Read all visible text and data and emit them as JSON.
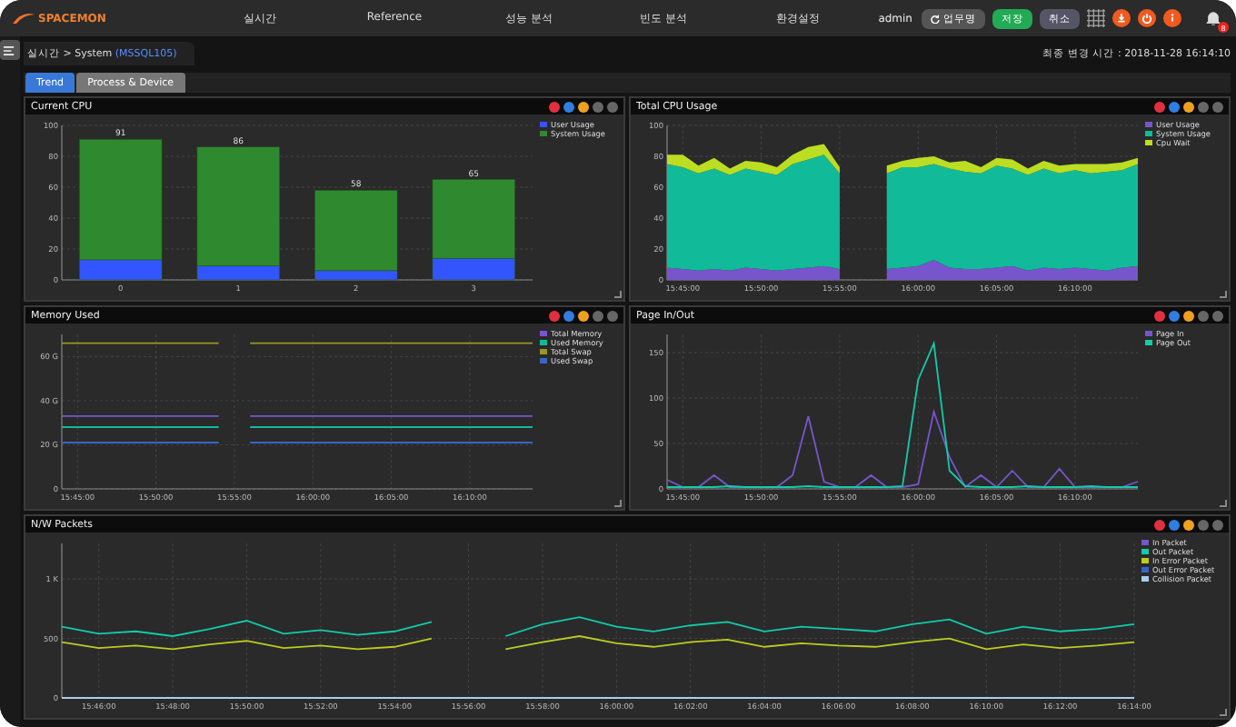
{
  "header": {
    "logo": "SPACEMON",
    "menu": [
      {
        "label": "실시간"
      },
      {
        "label": "Reference"
      },
      {
        "label": "성능 분석"
      },
      {
        "label": "빈도 분석"
      },
      {
        "label": "환경설정"
      }
    ],
    "user": "admin",
    "task_button": "업무명",
    "save_button": "저장",
    "cancel_button": "취소",
    "notification_count": "8"
  },
  "breadcrumb": {
    "path": "실시간 > System",
    "server": "(MSSQL105)"
  },
  "last_changed": "최종 변경 시간 : 2018-11-28 16:14:10",
  "tabs": [
    {
      "label": "Trend",
      "selected": true
    },
    {
      "label": "Process & Device",
      "selected": false
    }
  ],
  "panels": [
    {
      "title": "Current CPU",
      "chart_data": {
        "type": "bar",
        "stacked": true,
        "grid": true,
        "legend": true,
        "categories": [
          "0",
          "1",
          "2",
          "3"
        ],
        "ylim": [
          0,
          100
        ],
        "yticks": [
          0,
          20,
          40,
          60,
          80,
          100
        ],
        "value_labels": [
          "91",
          "86",
          "58",
          "65"
        ],
        "series": [
          {
            "name": "User Usage",
            "color": "#3355ff",
            "values": [
              13,
              9,
              6,
              14
            ]
          },
          {
            "name": "System Usage",
            "color": "#2f8a2f",
            "values": [
              78,
              77,
              52,
              51
            ]
          }
        ]
      }
    },
    {
      "title": "Total CPU Usage",
      "chart_data": {
        "type": "area",
        "stacked": true,
        "grid": true,
        "legend": true,
        "categories": [
          null,
          "15:45:00",
          null,
          null,
          null,
          null,
          "15:50:00",
          null,
          null,
          null,
          null,
          "15:55:00",
          null,
          null,
          null,
          null,
          "16:00:00",
          null,
          null,
          null,
          null,
          "16:05:00",
          null,
          null,
          null,
          null,
          "16:10:00",
          null,
          null,
          null,
          null
        ],
        "ylim": [
          0,
          100
        ],
        "yticks": [
          0,
          20,
          40,
          60,
          80,
          100
        ],
        "series": [
          {
            "name": "User Usage",
            "color": "#7755cc",
            "values": [
              8,
              7,
              6,
              7,
              6,
              8,
              7,
              6,
              7,
              8,
              9,
              7,
              null,
              null,
              7,
              8,
              9,
              13,
              8,
              7,
              7,
              8,
              9,
              6,
              8,
              7,
              8,
              7,
              6,
              8,
              9
            ]
          },
          {
            "name": "System Usage",
            "color": "#11bb99",
            "values": [
              67,
              66,
              63,
              65,
              62,
              64,
              63,
              62,
              68,
              70,
              72,
              62,
              null,
              null,
              62,
              65,
              64,
              62,
              64,
              63,
              62,
              66,
              63,
              62,
              64,
              62,
              63,
              62,
              64,
              63,
              66
            ]
          },
          {
            "name": "Cpu Wait",
            "color": "#bbdd22",
            "values": [
              6,
              8,
              5,
              7,
              4,
              5,
              6,
              5,
              6,
              8,
              7,
              4,
              null,
              null,
              5,
              4,
              6,
              5,
              4,
              7,
              4,
              5,
              6,
              4,
              5,
              5,
              4,
              6,
              5,
              5,
              4
            ]
          }
        ]
      }
    },
    {
      "title": "Memory Used",
      "chart_data": {
        "type": "line",
        "grid": true,
        "legend": true,
        "categories": [
          null,
          "15:45:00",
          null,
          null,
          null,
          null,
          "15:50:00",
          null,
          null,
          null,
          null,
          "15:55:00",
          null,
          null,
          null,
          null,
          "16:00:00",
          null,
          null,
          null,
          null,
          "16:05:00",
          null,
          null,
          null,
          null,
          "16:10:00",
          null,
          null,
          null,
          null
        ],
        "ylim": [
          0,
          70
        ],
        "yticks": [
          0,
          {
            "value": 20,
            "label": "20 G"
          },
          {
            "value": 40,
            "label": "40 G"
          },
          {
            "value": 60,
            "label": "60 G"
          }
        ],
        "series": [
          {
            "name": "Total Memory",
            "color": "#7755cc",
            "values": [
              33,
              33,
              33,
              33,
              33,
              33,
              33,
              33,
              33,
              33,
              33,
              null,
              33,
              33,
              33,
              33,
              33,
              33,
              33,
              33,
              33,
              33,
              33,
              33,
              33,
              33,
              33,
              33,
              33,
              33,
              33
            ]
          },
          {
            "name": "Used Memory",
            "color": "#11bb99",
            "values": [
              28,
              28,
              28,
              28,
              28,
              28,
              28,
              28,
              28,
              28,
              28,
              null,
              28,
              28,
              28,
              28,
              28,
              28,
              28,
              28,
              28,
              28,
              28,
              28,
              28,
              28,
              28,
              28,
              28,
              28,
              28
            ]
          },
          {
            "name": "Total Swap",
            "color": "#999922",
            "values": [
              66,
              66,
              66,
              66,
              66,
              66,
              66,
              66,
              66,
              66,
              66,
              null,
              66,
              66,
              66,
              66,
              66,
              66,
              66,
              66,
              66,
              66,
              66,
              66,
              66,
              66,
              66,
              66,
              66,
              66,
              66
            ]
          },
          {
            "name": "Used Swap",
            "color": "#3366cc",
            "values": [
              21,
              21,
              21,
              21,
              21,
              21,
              21,
              21,
              21,
              21,
              21,
              null,
              21,
              21,
              21,
              21,
              21,
              21,
              21,
              21,
              21,
              21,
              21,
              21,
              21,
              21,
              21,
              21,
              21,
              21,
              21
            ]
          }
        ]
      }
    },
    {
      "title": "Page In/Out",
      "chart_data": {
        "type": "line",
        "grid": true,
        "legend": true,
        "categories": [
          null,
          "15:45:00",
          null,
          null,
          null,
          null,
          "15:50:00",
          null,
          null,
          null,
          null,
          "15:55:00",
          null,
          null,
          null,
          null,
          "16:00:00",
          null,
          null,
          null,
          null,
          "16:05:00",
          null,
          null,
          null,
          null,
          "16:10:00",
          null,
          null,
          null,
          null
        ],
        "ylim": [
          0,
          170
        ],
        "yticks": [
          0,
          50,
          100,
          150
        ],
        "series": [
          {
            "name": "Page In",
            "color": "#7755cc",
            "values": [
              10,
              2,
              2,
              15,
              2,
              2,
              2,
              2,
              15,
              80,
              8,
              2,
              2,
              15,
              2,
              2,
              5,
              85,
              35,
              2,
              15,
              2,
              20,
              2,
              2,
              22,
              2,
              2,
              2,
              2,
              8
            ]
          },
          {
            "name": "Page Out",
            "color": "#11ccaa",
            "values": [
              2,
              2,
              2,
              2,
              3,
              2,
              2,
              2,
              2,
              3,
              2,
              2,
              2,
              2,
              2,
              3,
              120,
              160,
              20,
              3,
              2,
              2,
              2,
              3,
              2,
              2,
              2,
              3,
              2,
              2,
              2
            ]
          }
        ]
      }
    },
    {
      "title": "N/W Packets",
      "chart_data": {
        "type": "line",
        "grid": true,
        "legend": true,
        "categories": [
          null,
          "15:46:00",
          null,
          "15:48:00",
          null,
          "15:50:00",
          null,
          "15:52:00",
          null,
          "15:54:00",
          null,
          "15:56:00",
          null,
          "15:58:00",
          null,
          "16:00:00",
          null,
          "16:02:00",
          null,
          "16:04:00",
          null,
          "16:06:00",
          null,
          "16:08:00",
          null,
          "16:10:00",
          null,
          "16:12:00",
          null,
          "16:14:00"
        ],
        "ylim": [
          0,
          1300
        ],
        "yticks": [
          0,
          500,
          {
            "value": 1000,
            "label": "1 K"
          }
        ],
        "series": [
          {
            "name": "In Packet",
            "color": "#7755cc",
            "values": [
              null,
              null,
              null,
              null,
              null,
              null,
              null,
              null,
              null,
              null,
              null,
              null,
              null,
              null,
              null,
              null,
              null,
              null,
              null,
              null,
              null,
              null,
              null,
              null,
              null,
              null,
              null,
              null,
              null,
              null
            ]
          },
          {
            "name": "Out Packet",
            "color": "#11ccaa",
            "values": [
              600,
              540,
              560,
              520,
              580,
              650,
              540,
              570,
              530,
              560,
              640,
              null,
              520,
              620,
              680,
              600,
              560,
              610,
              640,
              560,
              600,
              580,
              560,
              620,
              660,
              540,
              600,
              560,
              580,
              620
            ]
          },
          {
            "name": "In Error Packet",
            "color": "#bbcc22",
            "values": [
              470,
              420,
              440,
              410,
              450,
              480,
              420,
              440,
              410,
              430,
              500,
              null,
              410,
              470,
              520,
              460,
              430,
              470,
              490,
              430,
              460,
              440,
              430,
              470,
              500,
              410,
              450,
              420,
              440,
              470
            ]
          },
          {
            "name": "Out Error Packet",
            "color": "#3366cc",
            "values": [
              null,
              null,
              null,
              null,
              null,
              null,
              null,
              null,
              null,
              null,
              null,
              null,
              null,
              null,
              null,
              null,
              null,
              null,
              null,
              null,
              null,
              null,
              null,
              null,
              null,
              null,
              null,
              null,
              null,
              null
            ]
          },
          {
            "name": "Collision Packet",
            "color": "#aaccee",
            "values": [
              0,
              0,
              0,
              0,
              0,
              0,
              0,
              0,
              0,
              0,
              0,
              0,
              0,
              0,
              0,
              0,
              0,
              0,
              0,
              0,
              0,
              0,
              0,
              0,
              0,
              0,
              0,
              0,
              0,
              0
            ]
          }
        ]
      }
    }
  ]
}
